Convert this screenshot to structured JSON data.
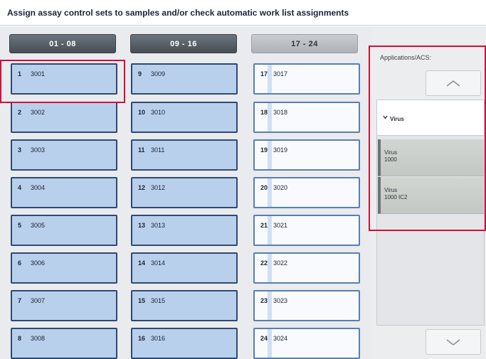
{
  "title": "Assign assay control sets to samples and/or check automatic work list assignments",
  "column_headers": [
    {
      "label": "01 - 08",
      "active": true
    },
    {
      "label": "09 - 16",
      "active": true
    },
    {
      "label": "17 - 24",
      "active": false
    }
  ],
  "columns": [
    [
      {
        "num": "1",
        "id": "3001"
      },
      {
        "num": "2",
        "id": "3002"
      },
      {
        "num": "3",
        "id": "3003"
      },
      {
        "num": "4",
        "id": "3004"
      },
      {
        "num": "5",
        "id": "3005"
      },
      {
        "num": "6",
        "id": "3006"
      },
      {
        "num": "7",
        "id": "3007"
      },
      {
        "num": "8",
        "id": "3008"
      }
    ],
    [
      {
        "num": "9",
        "id": "3009"
      },
      {
        "num": "10",
        "id": "3010"
      },
      {
        "num": "11",
        "id": "3011"
      },
      {
        "num": "12",
        "id": "3012"
      },
      {
        "num": "13",
        "id": "3013"
      },
      {
        "num": "14",
        "id": "3014"
      },
      {
        "num": "15",
        "id": "3015"
      },
      {
        "num": "16",
        "id": "3016"
      }
    ],
    [
      {
        "num": "17",
        "id": "3017"
      },
      {
        "num": "18",
        "id": "3018"
      },
      {
        "num": "19",
        "id": "3019"
      },
      {
        "num": "20",
        "id": "3020"
      },
      {
        "num": "21",
        "id": "3021"
      },
      {
        "num": "22",
        "id": "3022"
      },
      {
        "num": "23",
        "id": "3023"
      },
      {
        "num": "24",
        "id": "3024"
      }
    ]
  ],
  "panel": {
    "label": "Applications/ACS:",
    "scroll_up_icon": "chevron-up-icon",
    "scroll_down_icon": "chevron-down-icon",
    "group": {
      "label": "Virus",
      "icon": "chevron-down-icon"
    },
    "items": [
      {
        "text": "Virus\n1000"
      },
      {
        "text": "Virus\n1000 IC2"
      }
    ]
  },
  "colors": {
    "assigned_cell": "#b9d0ec",
    "unassigned_cell": "#f8fafd",
    "highlight": "#d0103a"
  }
}
